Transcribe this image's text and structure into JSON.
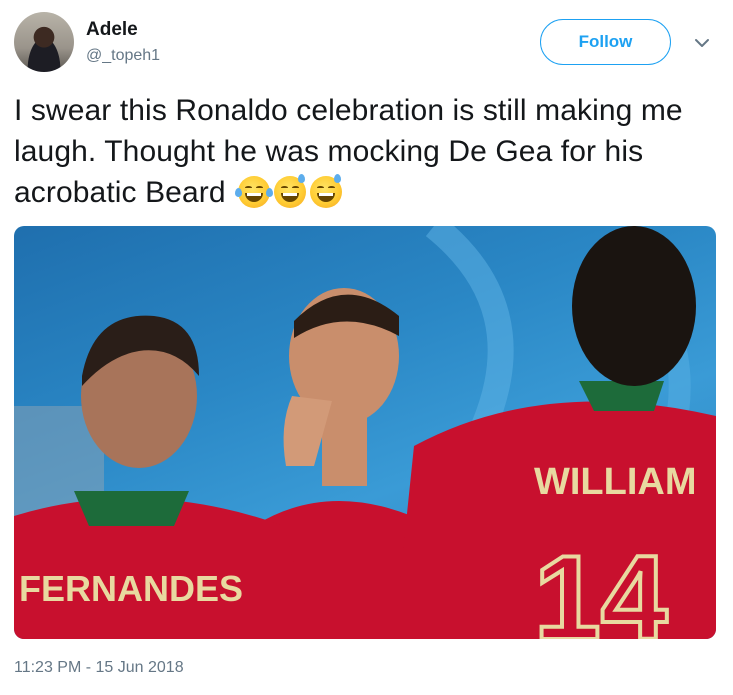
{
  "user": {
    "name": "Adele",
    "handle": "@_topeh1"
  },
  "actions": {
    "follow_label": "Follow",
    "more_icon": "chevron-down-icon"
  },
  "tweet": {
    "text": "I swear this Ronaldo celebration is still making me laugh. Thought he was mocking De Gea for his acrobatic Beard",
    "emojis": [
      "face-with-tears-of-joy",
      "grinning-face-with-sweat",
      "grinning-face-with-sweat"
    ],
    "timestamp": "11:23 PM - 15 Jun 2018"
  },
  "photo": {
    "jersey_left": "FERNANDES",
    "jersey_right": "WILLIAM",
    "jersey_number": "14"
  },
  "colors": {
    "accent": "#1da1f2",
    "text": "#14171a",
    "muted": "#657786"
  }
}
